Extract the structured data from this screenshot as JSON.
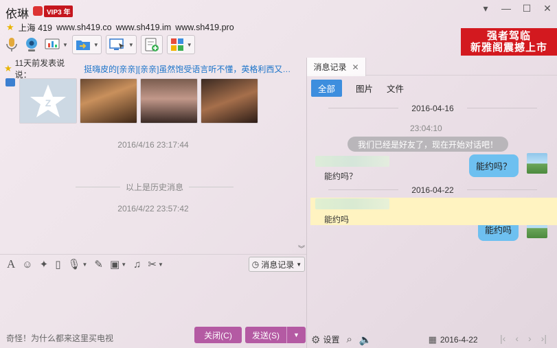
{
  "header": {
    "title": "依琳",
    "vip": "VIP3 年",
    "location": "上海 419",
    "sites": [
      "www.sh419.co",
      "www.sh419.im",
      "www.sh419.pro"
    ],
    "window_controls": [
      "▾",
      "—",
      "☐",
      "✕"
    ]
  },
  "ad": {
    "line1": "强者驾临",
    "line2": "新雅阁震撼上市",
    "color": "#d3191f"
  },
  "feed": {
    "time": "11天前发表说说：",
    "text": "挺嗨皮的[亲亲][亲亲]虽然饱受语言听不懂，英格利西又…"
  },
  "chat": {
    "ts1": "2016/4/16 23:17:44",
    "msg1": "能约吗？",
    "history_label": "以上是历史消息",
    "ts2": "2016/4/22 23:57:42",
    "msg2": "能约吗"
  },
  "input": {
    "hint": "奇怪！为什么都来这里买电视",
    "msg_record_label": "消息记录",
    "close_label": "关闭(C)",
    "send_label": "发送(S)"
  },
  "right": {
    "tab_label": "消息记录",
    "filters": [
      "全部",
      "图片",
      "文件"
    ],
    "date1": "2016-04-16",
    "time1": "23:04:10",
    "system_msg": "我们已经是好友了，现在开始对话吧！",
    "msg1": "能约吗？",
    "date2": "2016-04-22",
    "msg2": "能约吗",
    "settings_label": "设置",
    "bottom_date": "2016-4-22"
  },
  "colors": {
    "accent_blue": "#3d8ede",
    "bubble": "#6ec0f0",
    "button": "#b45aa3",
    "highlight": "#fff3c1"
  }
}
